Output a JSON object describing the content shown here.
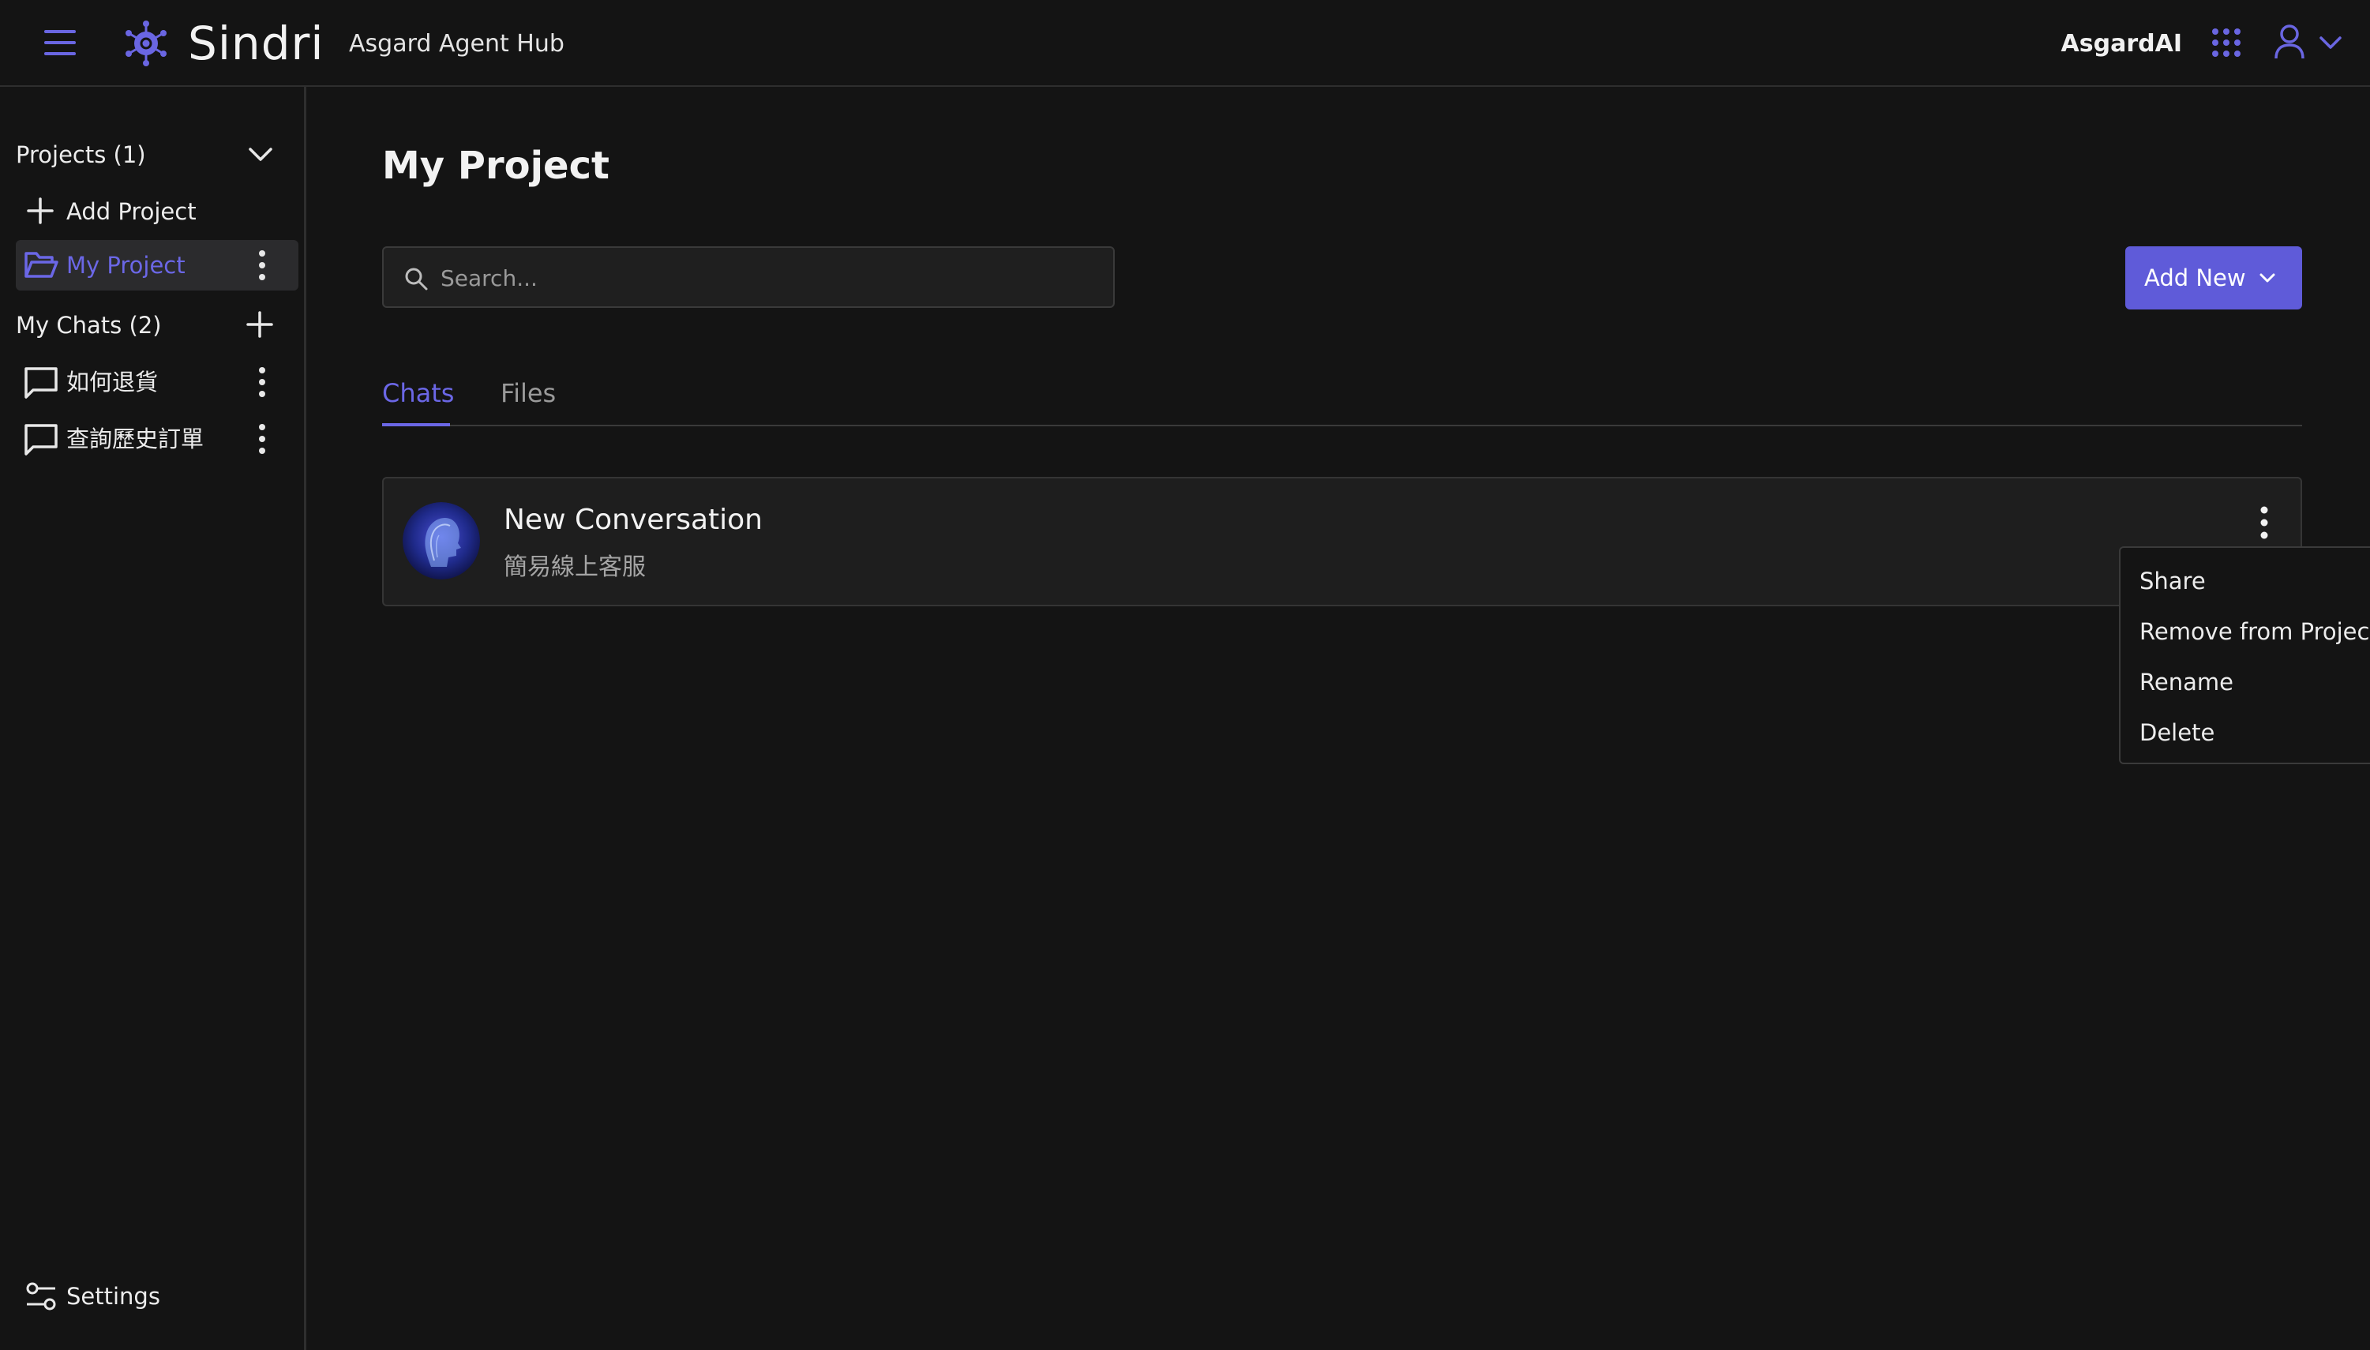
{
  "header": {
    "brand": "Sindri",
    "app_name": "Asgard Agent Hub",
    "org_name": "AsgardAI",
    "icons": [
      "hamburger-icon",
      "sindri-logo-icon",
      "apps-grid-icon",
      "user-icon",
      "chevron-down-icon"
    ]
  },
  "sidebar": {
    "projects_label": "Projects (1)",
    "add_project_label": "Add Project",
    "projects": [
      {
        "label": "My Project",
        "selected": true
      }
    ],
    "chats_label": "My Chats (2)",
    "chats": [
      {
        "label": "如何退貨"
      },
      {
        "label": "查詢歷史訂單"
      }
    ],
    "settings_label": "Settings"
  },
  "main": {
    "title": "My Project",
    "search": {
      "placeholder": "Search...",
      "value": ""
    },
    "add_new_label": "Add New",
    "tabs": [
      {
        "label": "Chats",
        "active": true
      },
      {
        "label": "Files",
        "active": false
      }
    ],
    "conversations": [
      {
        "title": "New Conversation",
        "subtitle": "簡易線上客服"
      }
    ]
  },
  "context_menu": {
    "items": [
      {
        "label": "Share"
      },
      {
        "label": "Remove from Project"
      },
      {
        "label": "Rename"
      },
      {
        "label": "Delete"
      }
    ]
  },
  "colors": {
    "background": "#141414",
    "accent": "#5f5bd9",
    "accent_text": "#6b67e6",
    "border": "#2e2e2e"
  }
}
